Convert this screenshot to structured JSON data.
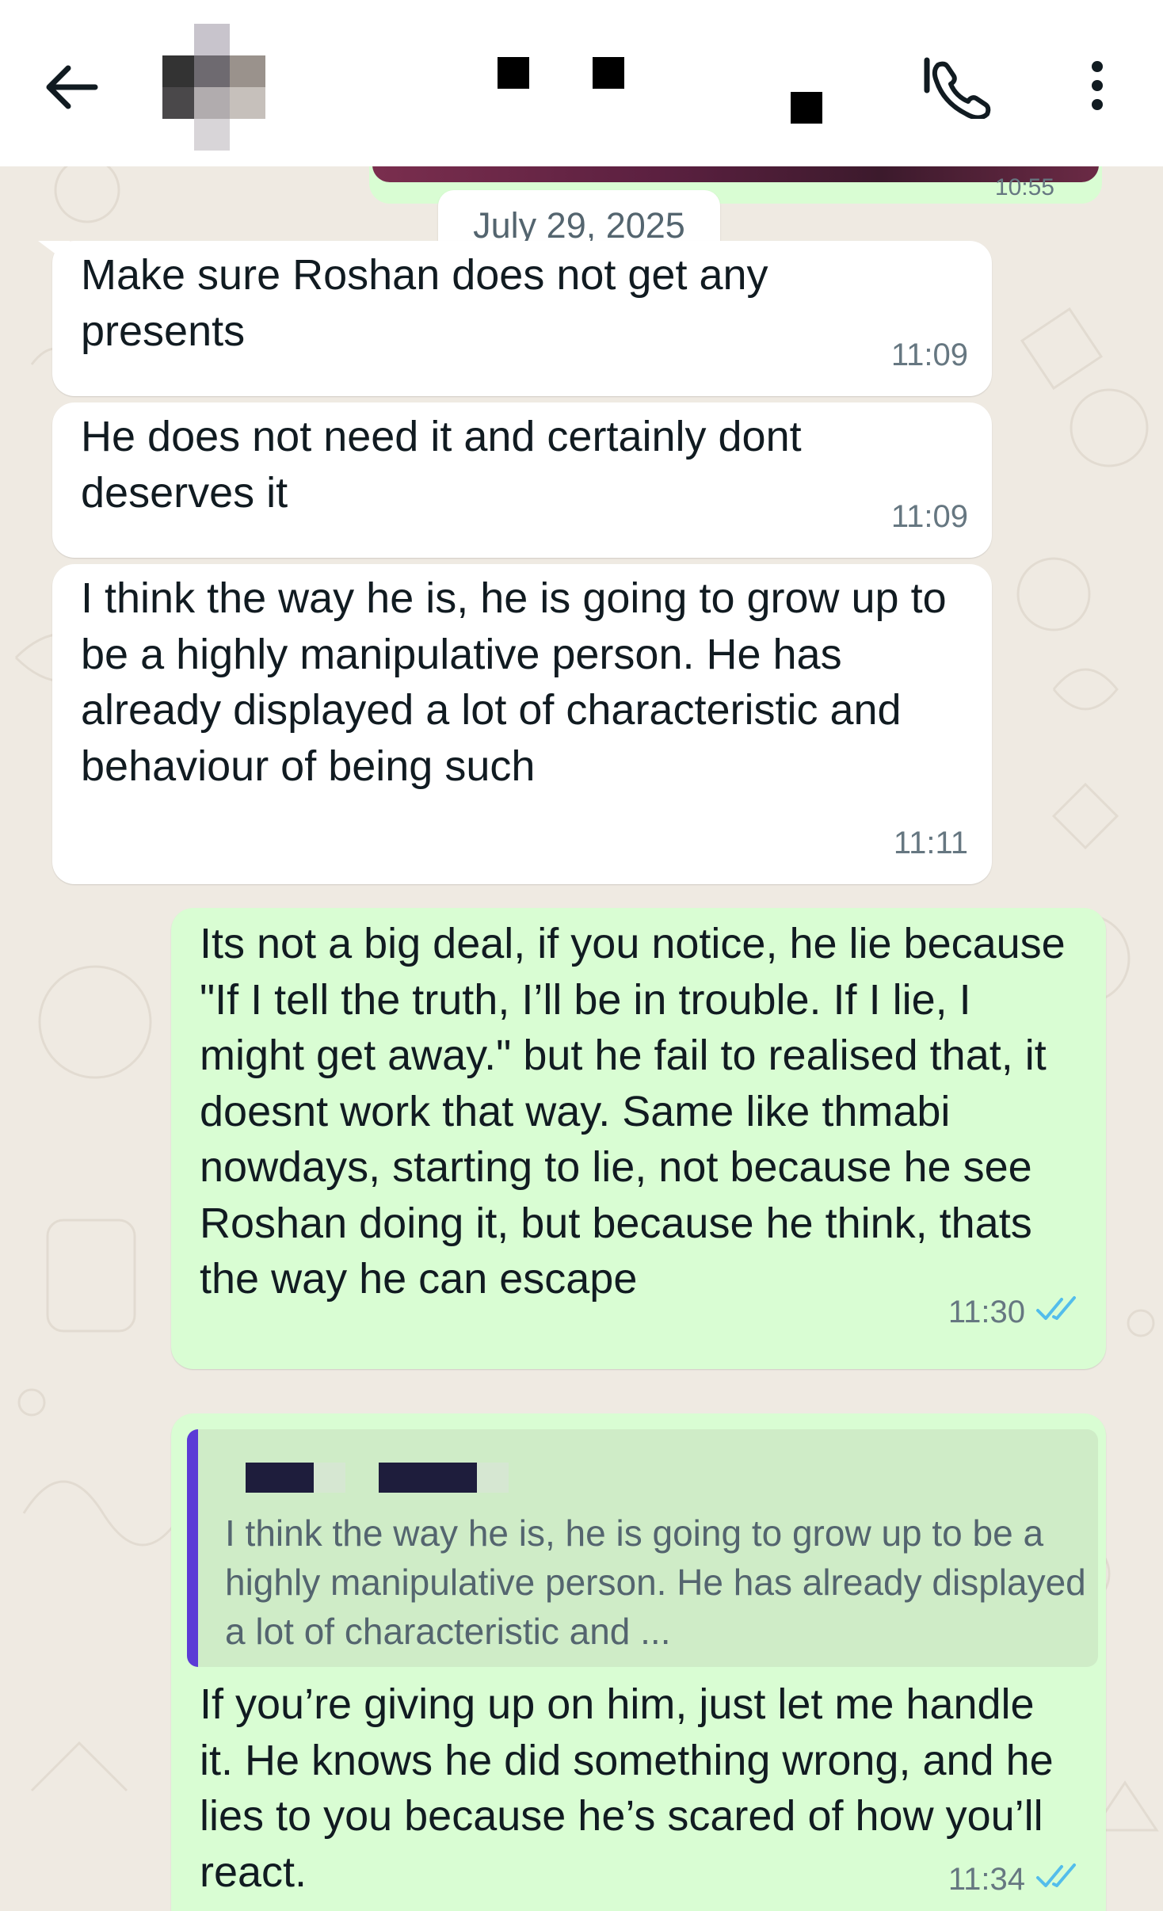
{
  "header": {
    "back_icon": "arrow-left-icon",
    "call_icon": "phone-add-icon",
    "menu_icon": "more-vert-icon"
  },
  "chat": {
    "previous_image_time": "10:55",
    "date_divider": "July 29, 2025",
    "messages": [
      {
        "direction": "in",
        "text": "Make sure Roshan does not get any presents",
        "time": "11:09"
      },
      {
        "direction": "in",
        "text": "He does not need it and certainly dont deserves it",
        "time": "11:09"
      },
      {
        "direction": "in",
        "text": "I think the way he is, he is going to grow up to be a highly manipulative person. He has already displayed a lot of characteristic and behaviour of being such",
        "time": "11:11"
      },
      {
        "direction": "out",
        "text": "Its not a big deal, if you notice, he lie because \"If I tell the truth, I’ll be in trouble. If I lie, I might get away.\" but he fail to realised that, it doesnt work that way. Same like thmabi nowdays, starting to lie, not because he see Roshan doing it, but because he think, thats the way he can escape",
        "time": "11:30",
        "status": "read"
      },
      {
        "direction": "out",
        "quoted_text": "I think the way he is, he is going to grow up to be a highly manipulative person. He has already displayed a lot of characteristic and ...",
        "text": "If you’re giving up on him, just let me handle it. He knows he did something wrong, and he lies to you because he’s scared of how you’ll react.",
        "time": "11:34",
        "status": "read"
      }
    ]
  },
  "colors": {
    "incoming_bubble": "#ffffff",
    "outgoing_bubble": "#d9fdd3",
    "read_ticks": "#53bdeb",
    "quote_bar": "#5b3bd6",
    "chat_background": "#efeae2"
  }
}
